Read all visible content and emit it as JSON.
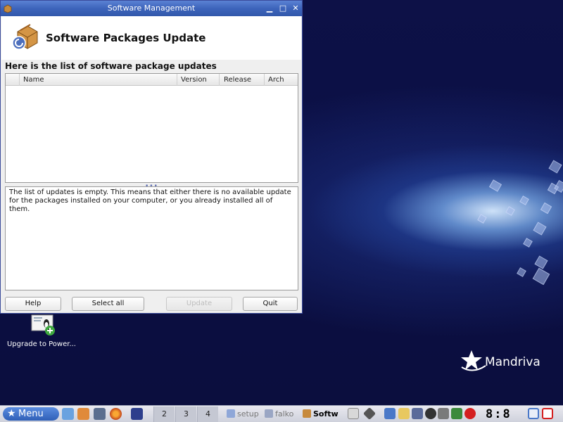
{
  "window": {
    "title": "Software Management",
    "header_title": "Software Packages Update",
    "subtitle": "Here is the list of software package updates",
    "columns": [
      "Name",
      "Version",
      "Release",
      "Arch"
    ],
    "rows": [],
    "description": "The list of updates is empty. This means that either there is no available update for the packages installed on your computer, or you already installed all of them.",
    "buttons": {
      "help": "Help",
      "select_all": "Select all",
      "update": "Update",
      "quit": "Quit"
    }
  },
  "desktop": {
    "icon_label": "Upgrade to Power...",
    "brand": "Mandriva"
  },
  "taskbar": {
    "menu_label": "Menu",
    "desktops": [
      "2",
      "3",
      "4"
    ],
    "tasks": [
      "setup",
      "falko",
      "Softw"
    ],
    "clock": "8:8"
  },
  "colors": {
    "titlebar": "#3d64bb",
    "desktop_bg": "#0b0f44",
    "menu_button": "#2f5fb7"
  }
}
